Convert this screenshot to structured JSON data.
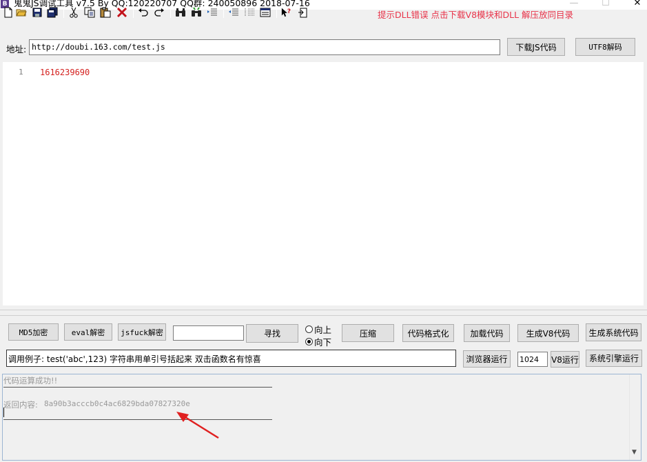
{
  "titlebar": {
    "app_icon_letter": "B",
    "title": "鬼鬼JS调试工具 v7.5 By QQ:120220707  QQ群: 240050896  2018-07-16",
    "minimize": "—",
    "maximize": "☐",
    "close": "✕"
  },
  "toolbar": {
    "tip": "提示DLL错误  点击下载V8模块和DLL  解压放同目录",
    "icons": [
      "new-file",
      "open-folder",
      "save",
      "save-all",
      "cut",
      "copy",
      "paste",
      "delete",
      "undo",
      "redo",
      "find",
      "find-next",
      "outdent",
      "indent",
      "list",
      "help-cursor",
      "exit"
    ]
  },
  "address": {
    "label": "地址:",
    "value": "http://doubi.163.com/test.js",
    "download_button": "下载JS代码",
    "utf8_button": "UTF8解码"
  },
  "editor": {
    "lines": [
      {
        "number": "1",
        "text": "1616239690"
      }
    ]
  },
  "controls": {
    "md5_button": "MD5加密",
    "eval_button": "eval解密",
    "jsfuck_button": "jsfuck解密",
    "search_value": "",
    "find_button": "寻找",
    "radio_up": "向上",
    "radio_down": "向下",
    "radio_selected": "向下",
    "compress_button": "压缩",
    "format_button": "代码格式化",
    "load_button": "加载代码",
    "gen_v8_button": "生成V8代码",
    "gen_sys_button": "生成系统代码",
    "example_text": "调用例子: test('abc',123) 字符串用单引号括起来 双击函数名有惊喜",
    "browser_run_button": "浏览器运行",
    "size_value": "1024",
    "v8_run_button": "V8运行",
    "sys_run_button": "系统引擎运行"
  },
  "output": {
    "status_line": "代码运算成功!!",
    "result_label": "返回内容:",
    "result_value": "8a90b3acccb0c4ac6829bda07827320e",
    "scroll_down": "▼",
    "annotation_color": "#e02020"
  }
}
